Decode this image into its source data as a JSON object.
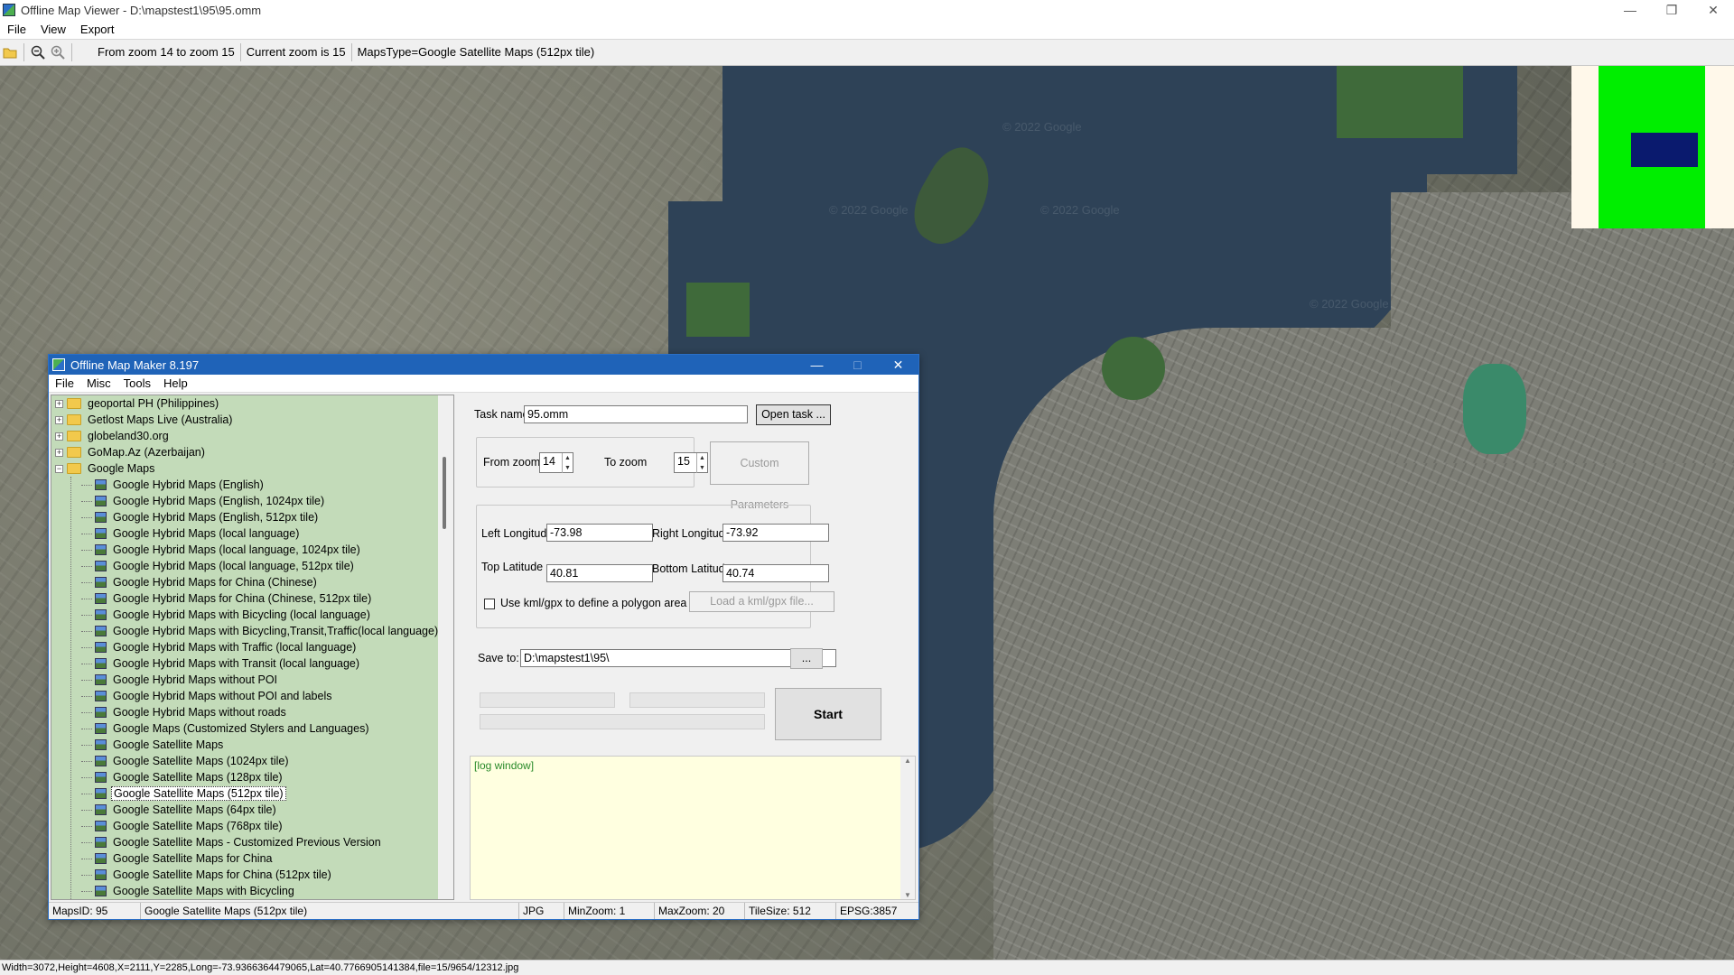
{
  "viewer": {
    "title": "Offline Map Viewer - D:\\mapstest1\\95\\95.omm",
    "menu": [
      "File",
      "View",
      "Export"
    ],
    "toolbar": {
      "zoom_range": "From zoom 14 to zoom 15",
      "current_zoom": "Current zoom is 15",
      "maps_type": "MapsType=Google Satellite Maps (512px tile)"
    },
    "watermark": "© 2022 Google",
    "status": "Width=3072,Height=4608,X=2111,Y=2285,Long=-73.9366364479065,Lat=40.7766905141384,file=15/9654/12312.jpg",
    "minimap_colors": {
      "background": "#fff8ea",
      "area": "#00ee00",
      "view": "#0a1a6e"
    }
  },
  "dialog": {
    "title": "Offline Map Maker 8.197",
    "menu": [
      "File",
      "Misc",
      "Tools",
      "Help"
    ],
    "tree": {
      "folders": [
        {
          "label": "geoportal PH (Philippines)",
          "expanded": false
        },
        {
          "label": "Getlost Maps Live (Australia)",
          "expanded": false
        },
        {
          "label": "globeland30.org",
          "expanded": false
        },
        {
          "label": "GoMap.Az (Azerbaijan)",
          "expanded": false
        },
        {
          "label": "Google Maps",
          "expanded": true
        }
      ],
      "children": [
        "Google Hybrid Maps (English)",
        "Google Hybrid Maps (English, 1024px tile)",
        "Google Hybrid Maps (English, 512px tile)",
        "Google Hybrid Maps (local language)",
        "Google Hybrid Maps (local language, 1024px tile)",
        "Google Hybrid Maps (local language, 512px tile)",
        "Google Hybrid Maps for China (Chinese)",
        "Google Hybrid Maps for China (Chinese, 512px tile)",
        "Google Hybrid Maps with Bicycling (local language)",
        "Google Hybrid Maps with Bicycling,Transit,Traffic(local language)",
        "Google Hybrid Maps with Traffic (local language)",
        "Google Hybrid Maps with Transit (local language)",
        "Google Hybrid Maps without POI",
        "Google Hybrid Maps without POI and labels",
        "Google Hybrid Maps without roads",
        "Google Maps (Customized Stylers and Languages)",
        "Google Satellite Maps",
        "Google Satellite Maps (1024px tile)",
        "Google Satellite Maps (128px tile)",
        "Google Satellite Maps (512px tile)",
        "Google Satellite Maps (64px tile)",
        "Google Satellite Maps (768px tile)",
        "Google Satellite Maps - Customized Previous Version",
        "Google Satellite Maps for China",
        "Google Satellite Maps for China (512px tile)",
        "Google Satellite Maps with Bicycling"
      ],
      "selected": "Google Satellite Maps (512px tile)"
    },
    "task_name_label": "Task name",
    "task_name_value": "95.omm",
    "open_task_label": "Open task ...",
    "from_zoom_label": "From zoom",
    "from_zoom_value": "14",
    "to_zoom_label": "To zoom",
    "to_zoom_value": "15",
    "custom_params_label": "Custom Parameters",
    "left_lon_label": "Left Longitude",
    "left_lon_value": "-73.98",
    "right_lon_label": "Right Longitude",
    "right_lon_value": "-73.92",
    "top_lat_label": "Top Latitude",
    "top_lat_value": "40.81",
    "bottom_lat_label": "Bottom Latitude",
    "bottom_lat_value": "40.74",
    "kml_checkbox_label": "Use kml/gpx to define a polygon area",
    "kml_checked": false,
    "load_kml_label": "Load a kml/gpx file...",
    "save_to_label": "Save to:",
    "save_to_value": "D:\\mapstest1\\95\\",
    "browse_label": "...",
    "start_label": "Start",
    "log_text": "[log window]",
    "status": {
      "maps_id": "MapsID: 95",
      "maps_name": "Google Satellite Maps (512px tile)",
      "format": "JPG",
      "min_zoom": "MinZoom: 1",
      "max_zoom": "MaxZoom: 20",
      "tile_size": "TileSize: 512",
      "epsg": "EPSG:3857"
    }
  }
}
